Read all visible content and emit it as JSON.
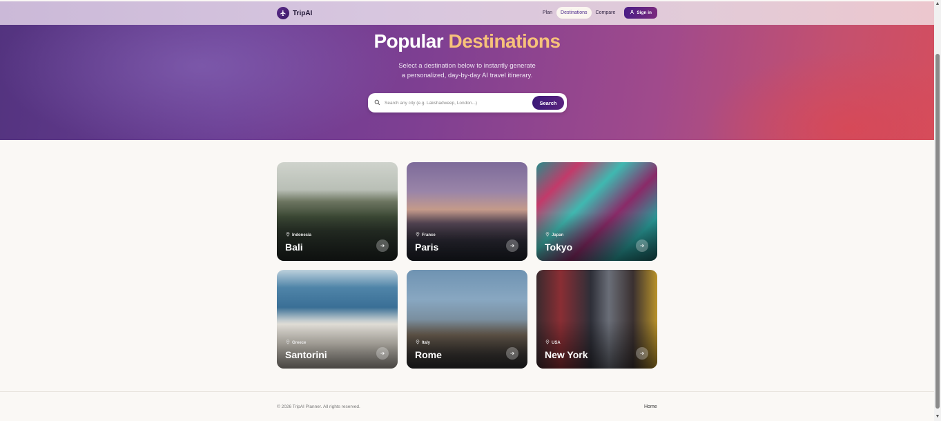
{
  "brand": {
    "name": "TripAI"
  },
  "nav": {
    "links": [
      {
        "label": "Plan"
      },
      {
        "label": "Destinations"
      },
      {
        "label": "Compare"
      }
    ],
    "signin_label": "Sign in"
  },
  "hero": {
    "title_part1": "Popular",
    "title_part2": "Destinations",
    "subtitle_line1": "Select a destination below to instantly generate",
    "subtitle_line2": "a personalized, day-by-day AI travel itinerary.",
    "search_placeholder": "Search any city (e.g. Lakshadweep, London...)",
    "search_button": "Search"
  },
  "destinations": [
    {
      "city": "Bali",
      "country": "Indonesia"
    },
    {
      "city": "Paris",
      "country": "France"
    },
    {
      "city": "Tokyo",
      "country": "Japan"
    },
    {
      "city": "Santorini",
      "country": "Greece"
    },
    {
      "city": "Rome",
      "country": "Italy"
    },
    {
      "city": "New York",
      "country": "USA"
    }
  ],
  "footer": {
    "copyright": "© 2026 TripAI Planner. All rights reserved.",
    "home_link": "Home"
  },
  "colors": {
    "accent": "#f7c27a",
    "primary": "#4a1d86"
  }
}
